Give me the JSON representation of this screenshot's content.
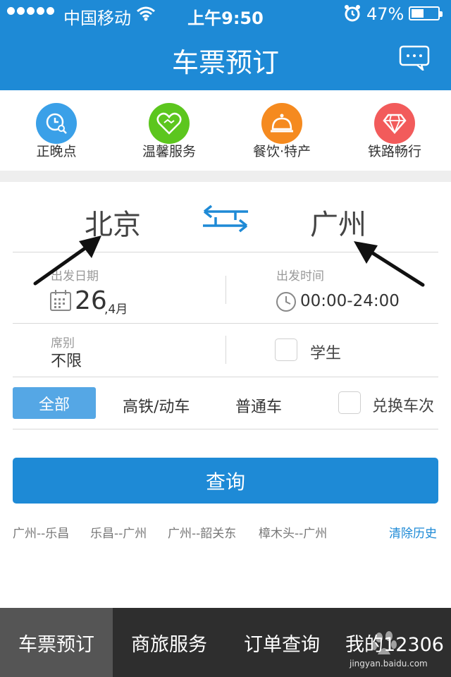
{
  "status_bar": {
    "carrier": "中国移动",
    "time": "上午9:50",
    "battery": "47%",
    "battery_level": 0.47
  },
  "header": {
    "title": "车票预订"
  },
  "quick_nav": [
    {
      "label": "正晚点",
      "icon": "clock-search-icon",
      "color": "#3aa0e8"
    },
    {
      "label": "温馨服务",
      "icon": "heart-handshake-icon",
      "color": "#5cc61e"
    },
    {
      "label": "餐饮·特产",
      "icon": "food-bell-icon",
      "color": "#f58a1f"
    },
    {
      "label": "铁路畅行",
      "icon": "diamond-icon",
      "color": "#f25b5b"
    }
  ],
  "route": {
    "from": "北京",
    "to": "广州"
  },
  "departure": {
    "date_label": "出发日期",
    "day": "26",
    "month": ",4月",
    "time_label": "出发时间",
    "time_range": "00:00-24:00"
  },
  "seat": {
    "label": "席别",
    "value": "不限"
  },
  "student": {
    "label": "学生"
  },
  "train_types": {
    "all": "全部",
    "high_speed": "高铁/动车",
    "normal": "普通车"
  },
  "exchange": {
    "label": "兑换车次"
  },
  "query_button": "查询",
  "history": [
    "广州--乐昌",
    "乐昌--广州",
    "广州--韶关东",
    "樟木头--广州"
  ],
  "clear_history": "清除历史",
  "tabbar": [
    "车票预订",
    "商旅服务",
    "订单查询",
    "我的12306"
  ],
  "watermark": {
    "main": "Bai 经验",
    "sub": "jingyan.baidu.com"
  },
  "colors": {
    "primary": "#1e8ad6",
    "tab_active_bg": "#555555",
    "tabbar_bg": "#2e2e2e"
  }
}
